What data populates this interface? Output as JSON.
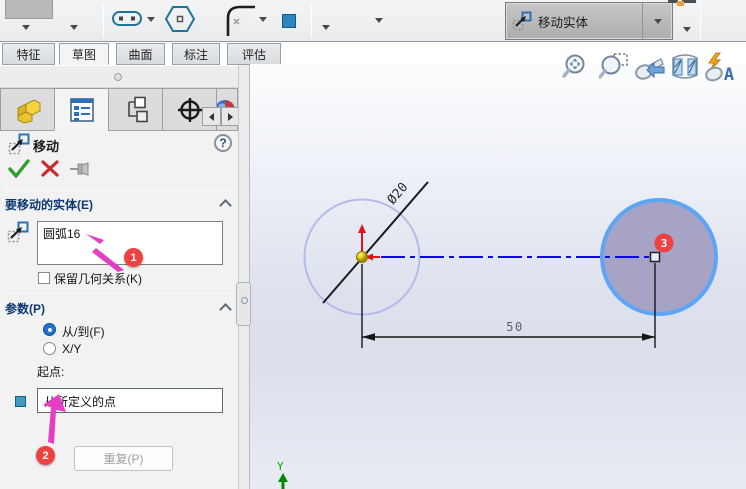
{
  "toolbar": {
    "move_entities_label": "移动实体"
  },
  "command_tabs": [
    "特征",
    "草图",
    "曲面",
    "标注",
    "评估"
  ],
  "panel": {
    "title": "移动",
    "help_glyph": "?",
    "entities_section": {
      "title": "要移动的实体(E)",
      "selection_value": "圆弧16",
      "keep_relations_label": "保留几何关系(K)"
    },
    "parameters_section": {
      "title": "参数(P)",
      "from_to_label": "从/到(F)",
      "xy_label": "X/Y",
      "start_point_label": "起点:",
      "start_point_value": "从所定义的点",
      "repeat_button_label": "重复(P)"
    }
  },
  "callouts": {
    "badge_1": "1",
    "badge_2": "2",
    "badge_3": "3"
  },
  "canvas": {
    "dimension_value": "50",
    "diameter_label": "Ø20",
    "y_axis_label": "Y"
  },
  "colors": {
    "selection_fill": "#a39fc2",
    "selection_outline": "#5ea6f5",
    "centerline_blue": "#0909e0",
    "badge_red": "#ee4141",
    "callout_arrow_magenta": "#e43fc3",
    "radio_accent_blue": "#1f6fd0"
  }
}
